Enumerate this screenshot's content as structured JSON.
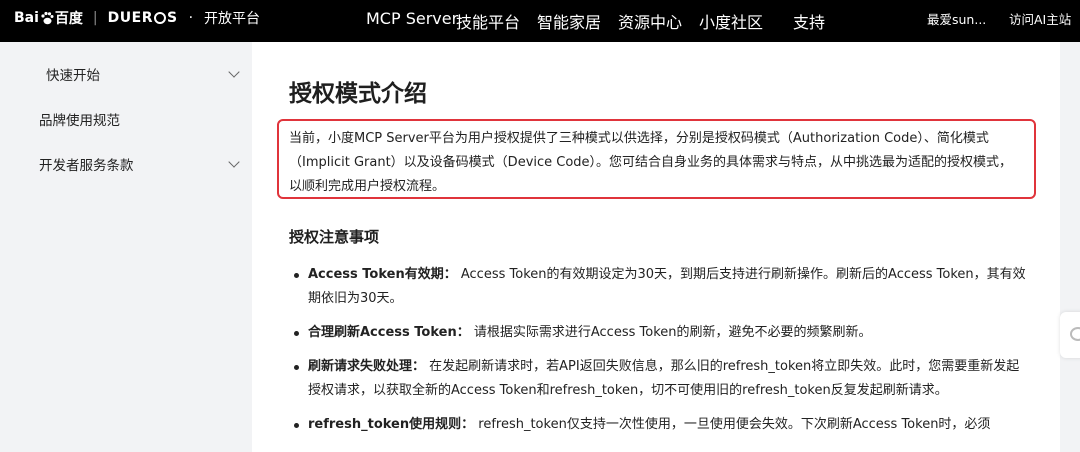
{
  "header": {
    "brand_baidu": "Bai",
    "brand_baidu_suffix": "百度",
    "brand_dueros_a": "DUER",
    "brand_dueros_b": "S",
    "brand_dot": "·",
    "brand_platform": "开放平台",
    "nav": [
      "MCP Server",
      "技能平台",
      "智能家居",
      "资源中心",
      "小度社区",
      "支持"
    ],
    "user_name": "最爱sun...",
    "visit_link": "访问AI主站"
  },
  "sidebar": {
    "items": [
      {
        "label": "快速开始",
        "has_chevron": true
      },
      {
        "label": "品牌使用规范",
        "has_chevron": false
      },
      {
        "label": "开发者服务条款",
        "has_chevron": true
      }
    ]
  },
  "main": {
    "title": "授权模式介绍",
    "intro": "当前，小度MCP Server平台为用户授权提供了三种模式以供选择，分别是授权码模式（Authorization Code）、简化模式（Implicit Grant）以及设备码模式（Device Code）。您可结合自身业务的具体需求与特点，从中挑选最为适配的授权模式，以顺利完成用户授权流程。",
    "section_title": "授权注意事项",
    "bullets": [
      {
        "term": "Access Token有效期：",
        "text": " Access Token的有效期设定为30天，到期后支持进行刷新操作。刷新后的Access Token，其有效期依旧为30天。"
      },
      {
        "term": "合理刷新Access Token：",
        "text": " 请根据实际需求进行Access Token的刷新，避免不必要的频繁刷新。"
      },
      {
        "term": "刷新请求失败处理：",
        "text": " 在发起刷新请求时，若API返回失败信息，那么旧的refresh_token将立即失效。此时，您需要重新发起授权请求，以获取全新的Access Token和refresh_token，切不可使用旧的refresh_token反复发起刷新请求。"
      },
      {
        "term": "refresh_token使用规则：",
        "text": " refresh_token仅支持一次性使用，一旦使用便会失效。下次刷新Access Token时，必须"
      }
    ]
  },
  "colors": {
    "topbar_bg": "#000000",
    "highlight_border": "#e0343b",
    "page_bg": "#f2f3f5"
  }
}
